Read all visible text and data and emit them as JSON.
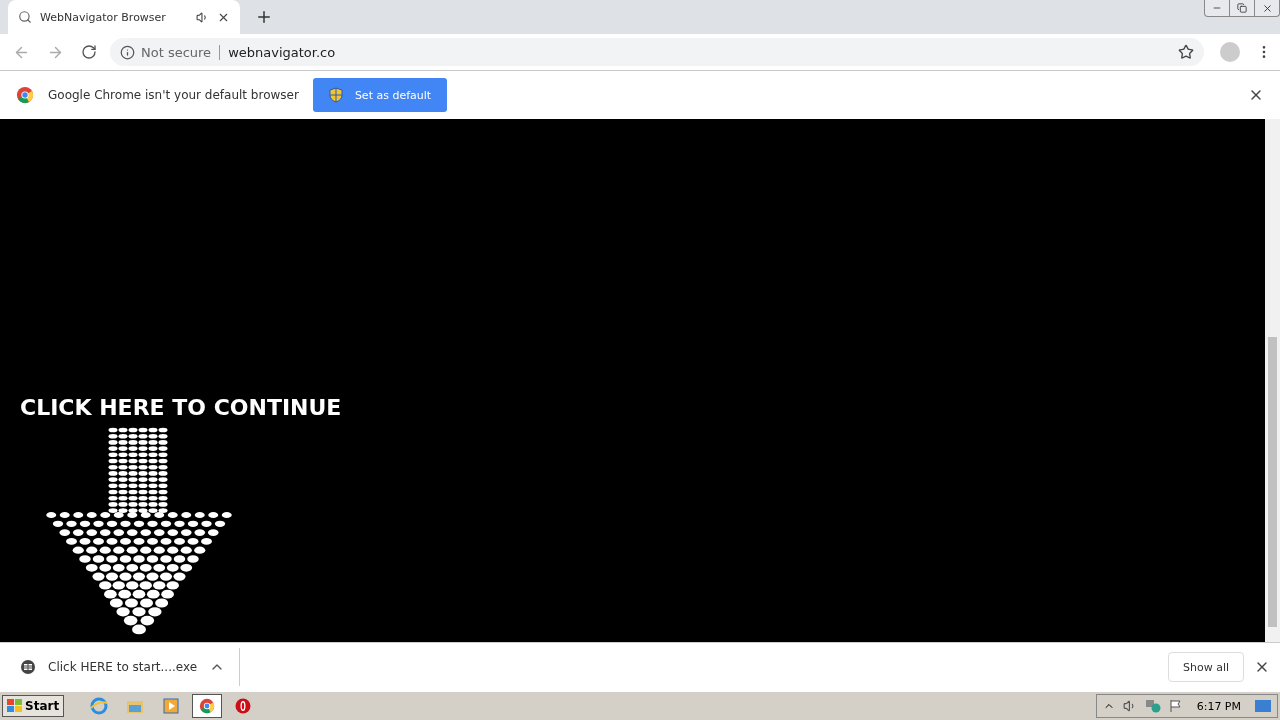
{
  "tab": {
    "title": "WebNavigator Browser",
    "selected": true
  },
  "address_bar": {
    "security": "Not secure",
    "url": "webnavigator.co"
  },
  "infobar": {
    "message": "Google Chrome isn't your default browser",
    "button": "Set as default"
  },
  "page": {
    "headline": "CLICK HERE TO CONTINUE"
  },
  "download_shelf": {
    "file": "Click HERE to start....exe",
    "show_all": "Show all"
  },
  "taskbar": {
    "start": "Start",
    "apps": [
      {
        "selected": false
      },
      {
        "selected": false
      },
      {
        "selected": false
      },
      {
        "selected": true
      },
      {
        "selected": false
      }
    ],
    "clock": "6:17 PM"
  }
}
